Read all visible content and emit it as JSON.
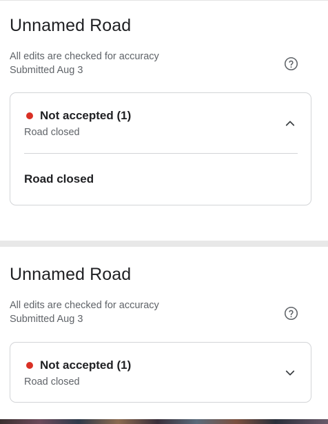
{
  "edits": [
    {
      "title": "Unnamed Road",
      "accuracy_note": "All edits are checked for accuracy",
      "submitted": "Submitted Aug 3",
      "status": {
        "label": "Not accepted (1)",
        "summary": "Road closed",
        "expanded": true,
        "detail": "Road closed"
      }
    },
    {
      "title": "Unnamed Road",
      "accuracy_note": "All edits are checked for accuracy",
      "submitted": "Submitted Aug 3",
      "status": {
        "label": "Not accepted (1)",
        "summary": "Road closed",
        "expanded": false
      }
    }
  ],
  "icons": {
    "help": "help-circle-icon",
    "expanded": "chevron-up-icon",
    "collapsed": "chevron-down-icon"
  },
  "colors": {
    "status_dot": "#d93025",
    "border": "#d2d4d7",
    "secondary_text": "#5f6368",
    "separator": "#e8e8e8"
  }
}
